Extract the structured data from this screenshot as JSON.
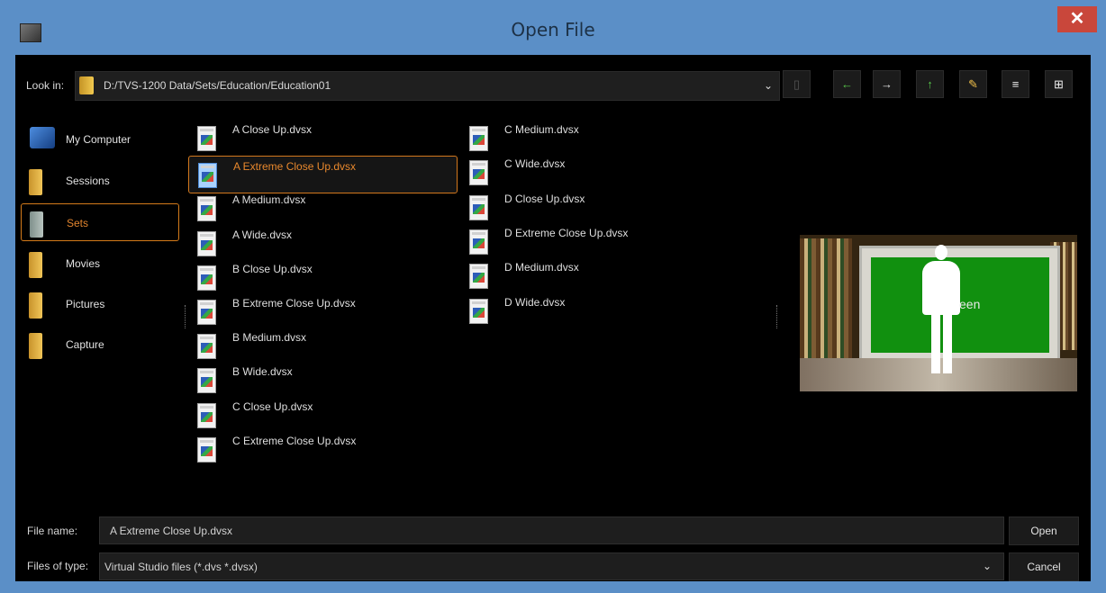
{
  "window": {
    "title": "Open File",
    "close_label": "✕"
  },
  "toolbar": {
    "look_in_label": "Look in:",
    "path": "D:/TVS-1200 Data/Sets/Education/Education01",
    "dropdown_arrow": "⌄"
  },
  "toolbar_buttons": {
    "disabled_button": "▯",
    "back_button": "←",
    "forward_button": "→",
    "up_button": "↑",
    "new_folder_button": "✎",
    "detail_view_button": "≡",
    "list_view_button": "⊞"
  },
  "sidebar": {
    "items": [
      {
        "label": "My Computer"
      },
      {
        "label": "Sessions"
      },
      {
        "label": "Sets"
      },
      {
        "label": "Movies"
      },
      {
        "label": "Pictures"
      },
      {
        "label": "Capture"
      }
    ]
  },
  "files": [
    {
      "name": "A Close Up.dvsx"
    },
    {
      "name": "A Extreme Close Up.dvsx"
    },
    {
      "name": "A Medium.dvsx"
    },
    {
      "name": "A Wide.dvsx"
    },
    {
      "name": "B Close Up.dvsx"
    },
    {
      "name": "B Extreme Close Up.dvsx"
    },
    {
      "name": "B Medium.dvsx"
    },
    {
      "name": "B Wide.dvsx"
    },
    {
      "name": "C Close Up.dvsx"
    },
    {
      "name": "C Extreme Close Up.dvsx"
    },
    {
      "name": "C Medium.dvsx"
    },
    {
      "name": "C Wide.dvsx"
    },
    {
      "name": "D Close Up.dvsx"
    },
    {
      "name": "D Extreme Close Up.dvsx"
    },
    {
      "name": "D Medium.dvsx"
    },
    {
      "name": "D Wide.dvsx"
    }
  ],
  "preview": {
    "screen_text": "een"
  },
  "footer": {
    "file_name_label": "File name:",
    "file_name_value": "A Extreme Close Up.dvsx",
    "files_of_type_label": "Files of type:",
    "files_of_type_value": "Virtual Studio files (*.dvs *.dvsx)",
    "open_button": "Open",
    "cancel_button": "Cancel"
  }
}
